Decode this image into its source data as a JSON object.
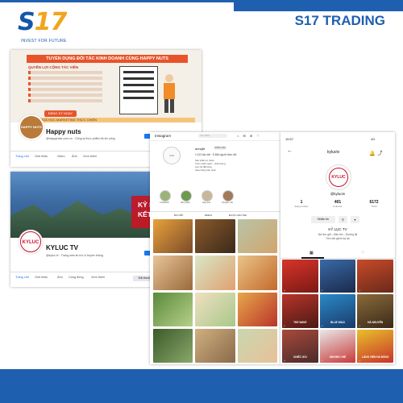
{
  "header": {
    "logo_text_s": "S",
    "logo_text_17": "17",
    "logo_tagline": "INVEST FOR FUTURE",
    "brand_title": "S17 TRADING"
  },
  "colors": {
    "brand_blue": "#1f5fb0",
    "brand_orange": "#f2a41c",
    "fb_blue": "#1877f2",
    "kyluc_red": "#c8102e"
  },
  "facebook_happynuts": {
    "cover_banner": "TUYỂN DỤNG ĐỐI TÁC KINH DOANH CÙNG HAPPY NUTS",
    "cover_subtitle": "QUYỀN LỢI CỘNG TÁC VIÊN",
    "cover_button": "ĐĂNG KÝ NGAY",
    "cover_bottom": "24 KHOÁ HỌC MARKETING THỰC CHIẾN",
    "avatar_text": "HAPPY NUTS",
    "page_name": "Happy nuts",
    "page_info": "@happynuts.com.vn · Công ty thực phẩm đồ ăn uống",
    "tabs": [
      "Trang chủ",
      "Giới thiệu",
      "Video",
      "Ảnh",
      "Xem thêm"
    ]
  },
  "facebook_kyluc": {
    "cover_text_1": "KỶ LỤC",
    "cover_text_2": "KẾT NỐI K",
    "avatar_text": "KYLUC",
    "page_name": "KYLUC TV",
    "page_info": "@kyluc.tv · Trang web tin tức & truyền thông",
    "tabs": [
      "Trang chủ",
      "Giới thiệu",
      "Ảnh",
      "Cộng đồng",
      "Xem thêm"
    ],
    "like_button": "Đã thích"
  },
  "instagram": {
    "logo": "Instagram",
    "search_placeholder": "Tìm kiếm",
    "avatar_text": "ANN",
    "username": "annqtlt",
    "edit_button": "Chỉnh sửa",
    "stats": "1.013 bài viết  ·  5.386 người theo dõi",
    "bio_lines": [
      "Sản phẩm tự nhiên",
      "Thực phẩm sạch – chất lượng",
      "Liên hệ đặt hàng",
      "Giao hàng toàn quốc"
    ],
    "highlights": [
      "Feedback",
      "Sản phẩm",
      "Hộp quà",
      "Khuyến mãi"
    ],
    "tabs": [
      "BÀI VIẾT",
      "REELS",
      "ĐƯỢC GẮN THẺ"
    ]
  },
  "tiktok": {
    "status_time": "15:57",
    "status_right": "4G",
    "handle": "kyluctv",
    "avatar_text": "KYLUC",
    "at_handle": "@kyluctv",
    "stats": [
      {
        "value": "1",
        "label": "Đang Follow"
      },
      {
        "value": "401",
        "label": "Follower"
      },
      {
        "value": "6172",
        "label": "Thích"
      }
    ],
    "message_button": "Nhắn tin",
    "name": "KỶ LỤC TV",
    "bio_lines": [
      "Nơi lưu giữ – Bảo tồn – Dương tài",
      "Tôn vinh giá trị kỷ lục"
    ],
    "videos": [
      {
        "caption": ""
      },
      {
        "caption": ""
      },
      {
        "caption": ""
      },
      {
        "caption": "THE WAVE"
      },
      {
        "caption": "BLUE WILD"
      },
      {
        "caption": "HÀ NGUYÊN"
      },
      {
        "caption": "CHIẾC GỐI"
      },
      {
        "caption": "WAVING CHẺ"
      },
      {
        "caption": "LÀNG VIÊN HÀ ĐÔNG"
      }
    ]
  }
}
